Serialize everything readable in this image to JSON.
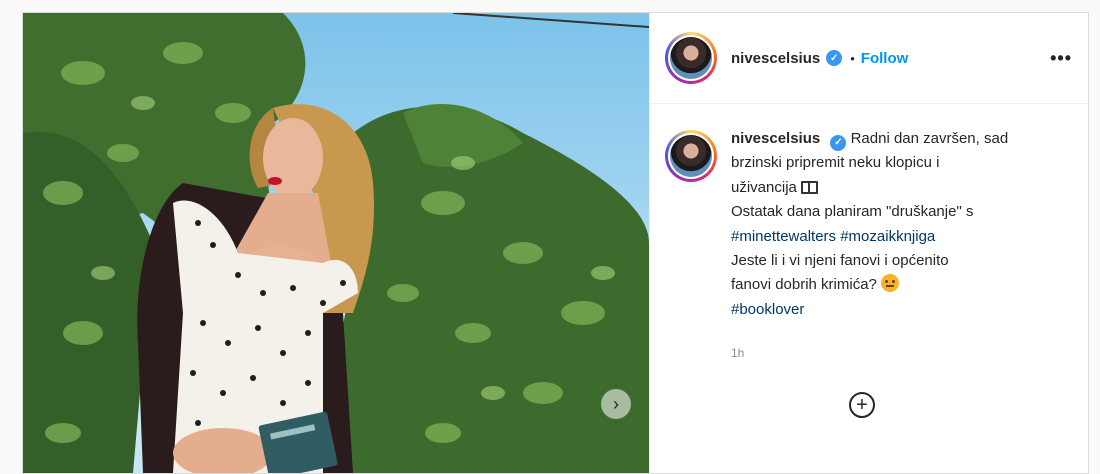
{
  "post": {
    "username": "nivescelsius",
    "separator": "•",
    "follow_label": "Follow",
    "more_label": "•••",
    "caption_lines": [
      "Radni dan završen, sad",
      "brzinski pripremit neku klopicu i",
      "uživancija"
    ],
    "caption_line4": "Ostatak dana planiram \"druškanje\" s",
    "hashtags_line": "#minettewalters #mozaikknjiga",
    "caption_line6": "Jeste li i vi njeni fanovi i općenito",
    "caption_line7": "fanovi dobrih krimića?",
    "hashtag_last": "#booklover",
    "timestamp": "1h",
    "add_comment_icon": "+"
  },
  "icons": {
    "verified": "verified-badge-icon",
    "more": "more-options-icon",
    "book": "book-emoji-icon",
    "emoji": "thinking-emoji-icon",
    "next": "carousel-next-icon",
    "add": "add-icon"
  },
  "colors": {
    "accent": "#0095f6",
    "hashtag": "#00376b",
    "verified": "#3897f0",
    "muted": "#8e8e8e"
  }
}
